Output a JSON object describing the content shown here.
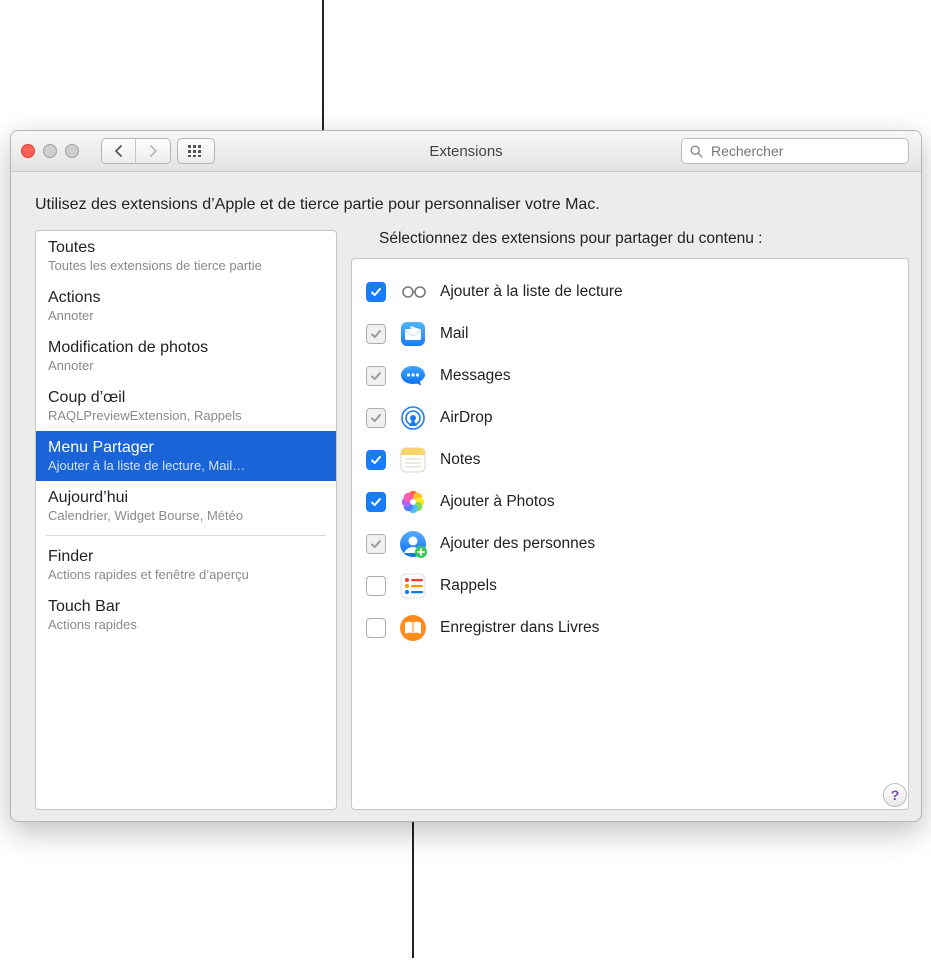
{
  "title": "Extensions",
  "subtitle": "Utilisez des extensions d’Apple et de tierce partie pour personnaliser votre Mac.",
  "search": {
    "placeholder": "Rechercher"
  },
  "sidebar": {
    "items": [
      {
        "title": "Toutes",
        "subtitle": "Toutes les extensions de tierce partie",
        "selected": false
      },
      {
        "title": "Actions",
        "subtitle": "Annoter",
        "selected": false
      },
      {
        "title": "Modification de photos",
        "subtitle": "Annoter",
        "selected": false
      },
      {
        "title": "Coup d’œil",
        "subtitle": "RAQLPreviewExtension, Rappels",
        "selected": false
      },
      {
        "title": "Menu Partager",
        "subtitle": "Ajouter à la liste de lecture, Mail…",
        "selected": true
      },
      {
        "title": "Aujourd’hui",
        "subtitle": "Calendrier, Widget Bourse, Météo",
        "selected": false
      },
      {
        "divider": true
      },
      {
        "title": "Finder",
        "subtitle": "Actions rapides et fenêtre d’aperçu",
        "selected": false
      },
      {
        "title": "Touch Bar",
        "subtitle": "Actions rapides",
        "selected": false
      }
    ]
  },
  "panel": {
    "title": "Sélectionnez des extensions pour partager du contenu :",
    "items": [
      {
        "label": "Ajouter à la liste de lecture",
        "state": "checked",
        "icon": "reading-list-icon"
      },
      {
        "label": "Mail",
        "state": "locked",
        "icon": "mail-icon"
      },
      {
        "label": "Messages",
        "state": "locked",
        "icon": "messages-icon"
      },
      {
        "label": "AirDrop",
        "state": "locked",
        "icon": "airdrop-icon"
      },
      {
        "label": "Notes",
        "state": "checked",
        "icon": "notes-icon"
      },
      {
        "label": "Ajouter à Photos",
        "state": "checked",
        "icon": "photos-icon"
      },
      {
        "label": "Ajouter des personnes",
        "state": "locked",
        "icon": "people-icon"
      },
      {
        "label": "Rappels",
        "state": "unchecked",
        "icon": "reminders-icon"
      },
      {
        "label": "Enregistrer dans Livres",
        "state": "unchecked",
        "icon": "books-icon"
      }
    ]
  },
  "colors": {
    "accent": "#1a7cf5",
    "selection": "#1a64d8"
  }
}
